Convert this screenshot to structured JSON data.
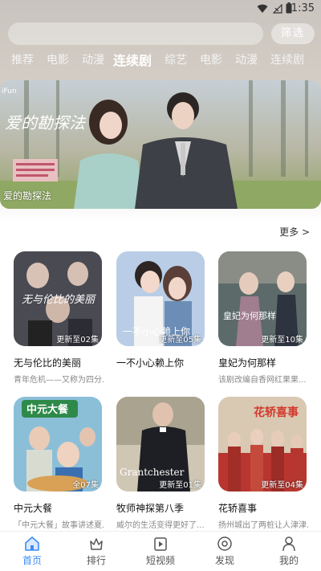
{
  "status_bar": {
    "time": "1:35"
  },
  "search": {
    "placeholder": "",
    "filter_label": "筛选"
  },
  "tabs": [
    {
      "label": "推荐",
      "active": false
    },
    {
      "label": "电影",
      "active": false
    },
    {
      "label": "动漫",
      "active": false
    },
    {
      "label": "连续剧",
      "active": true
    },
    {
      "label": "综艺",
      "active": false
    },
    {
      "label": "电影",
      "active": false
    },
    {
      "label": "动漫",
      "active": false
    },
    {
      "label": "连续剧",
      "active": false
    }
  ],
  "banner": {
    "title": "爱的勘探法",
    "poster_text": "爱的勘探法"
  },
  "section": {
    "more_label": "更多 >"
  },
  "cards": [
    {
      "title": "无与伦比的美丽",
      "desc": "青年危机——又称为四分...",
      "badge": "更新至02集"
    },
    {
      "title": "一不小心赖上你",
      "desc": "",
      "badge": "更新至05集"
    },
    {
      "title": "皇妃为何那样",
      "desc": "该剧改编自香网红果果...",
      "badge": "更新至10集"
    },
    {
      "title": "中元大餐",
      "desc": "「中元大餐」故事讲述夏...",
      "badge": "全07集"
    },
    {
      "title": "牧师神探第八季",
      "desc": "威尔的生活变得更好了...",
      "badge": "更新至01集"
    },
    {
      "title": "花轿喜事",
      "desc": "扬州城出了两桩让人津津...",
      "badge": "更新至04集"
    }
  ],
  "poster_texts": {
    "card0": "无与伦比的美丽",
    "card1": "一不小心赖上你",
    "card2": "皇妃为何那样",
    "card3": "中元大餐",
    "card4": "Grantchester",
    "card5": "花轿喜事"
  },
  "bottom_nav": [
    {
      "label": "首页",
      "icon": "home-icon",
      "active": true
    },
    {
      "label": "排行",
      "icon": "ranking-icon",
      "active": false
    },
    {
      "label": "短视频",
      "icon": "short-video-icon",
      "active": false
    },
    {
      "label": "发现",
      "icon": "discover-icon",
      "active": false
    },
    {
      "label": "我的",
      "icon": "profile-icon",
      "active": false
    }
  ],
  "colors": {
    "accent": "#3b8cf5"
  }
}
